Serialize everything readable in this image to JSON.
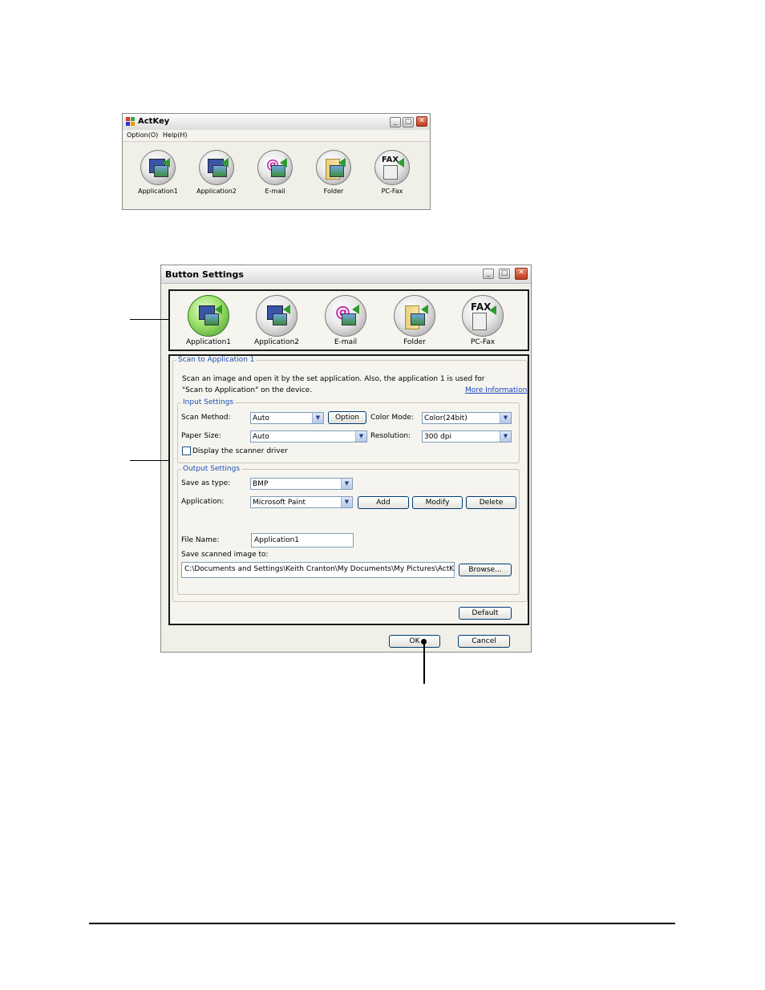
{
  "actkey": {
    "title": "ActKey",
    "menu": [
      "Option(O)",
      "Help(H)"
    ],
    "buttons": [
      "Application1",
      "Application2",
      "E-mail",
      "Folder",
      "PC-Fax"
    ]
  },
  "dialog": {
    "title": "Button Settings",
    "buttons": [
      "Application1",
      "Application2",
      "E-mail",
      "Folder",
      "PC-Fax"
    ],
    "selected_button": "Application1",
    "scan_group_title": "Scan to Application 1",
    "description_line1": "Scan an image and open it by the set application. Also, the application 1 is used for",
    "description_line2": "\"Scan to Application\" on the device.",
    "more_info_link": "More Information",
    "input_settings": {
      "title": "Input Settings",
      "scan_method_label": "Scan Method:",
      "scan_method_value": "Auto",
      "option_button": "Option",
      "color_mode_label": "Color Mode:",
      "color_mode_value": "Color(24bit)",
      "paper_size_label": "Paper Size:",
      "paper_size_value": "Auto",
      "resolution_label": "Resolution:",
      "resolution_value": "300 dpi",
      "scanner_driver_label": "Display the scanner driver",
      "scanner_driver_checked": false
    },
    "output_settings": {
      "title": "Output Settings",
      "save_type_label": "Save as type:",
      "save_type_value": "BMP",
      "application_label": "Application:",
      "application_value": "Microsoft Paint",
      "add_button": "Add",
      "modify_button": "Modify",
      "delete_button": "Delete",
      "file_name_label": "File Name:",
      "file_name_value": "Application1",
      "save_to_label": "Save scanned image to:",
      "save_to_value": "C:\\Documents and Settings\\Keith Cranton\\My Documents\\My Pictures\\ActKey\\",
      "browse_button": "Browse..."
    },
    "default_button": "Default",
    "ok_button": "OK",
    "cancel_button": "Cancel"
  },
  "window_controls": {
    "minimize": "_",
    "maximize": "□",
    "close": "✕"
  },
  "colors": {
    "group_title": "#1d4fb0",
    "link": "#1d3fbf",
    "active_button": "#5cbf3a",
    "close_button": "#c2391a"
  }
}
